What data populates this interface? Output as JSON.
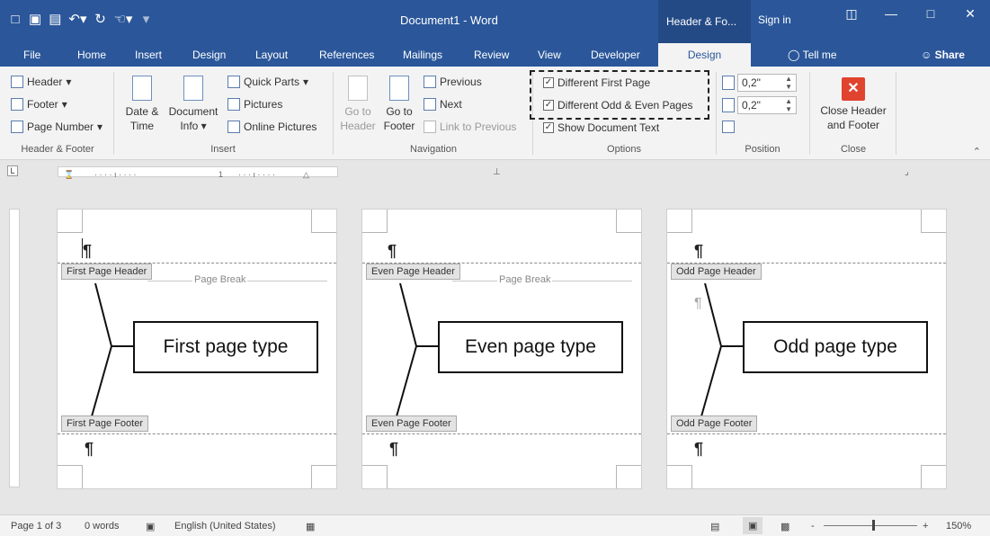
{
  "titlebar": {
    "qat_icons": [
      "new-document-icon",
      "save-icon",
      "save-as-icon",
      "undo-icon",
      "redo-icon",
      "touch-mode-icon",
      "customize-icon"
    ],
    "doc_title": "Document1  -  Word",
    "context_title": "Header & Fo...",
    "signin": "Sign in",
    "window_buttons": [
      "ribbon-display-icon",
      "minimize-icon",
      "maximize-icon",
      "close-icon"
    ]
  },
  "tabs": {
    "items": [
      "File",
      "Home",
      "Insert",
      "Design",
      "Layout",
      "References",
      "Mailings",
      "Review",
      "View",
      "Developer"
    ],
    "active": "Design",
    "tellme": "Tell me",
    "share": "Share"
  },
  "ribbon": {
    "header_footer": {
      "header": "Header",
      "footer": "Footer",
      "page_number": "Page Number",
      "label": "Header & Footer"
    },
    "insert": {
      "date_time_1": "Date &",
      "date_time_2": "Time",
      "doc_info_1": "Document",
      "doc_info_2": "Info",
      "quick_parts": "Quick Parts",
      "pictures": "Pictures",
      "online_pictures": "Online Pictures",
      "label": "Insert"
    },
    "navigation": {
      "goto_header_1": "Go to",
      "goto_header_2": "Header",
      "goto_footer_1": "Go to",
      "goto_footer_2": "Footer",
      "previous": "Previous",
      "next": "Next",
      "link_previous": "Link to Previous",
      "label": "Navigation"
    },
    "options": {
      "diff_first": "Different First Page",
      "diff_odd_even": "Different Odd & Even Pages",
      "show_doc_text": "Show Document Text",
      "label": "Options"
    },
    "position": {
      "header_pos": "0,2\"",
      "footer_pos": "0,2\"",
      "label": "Position"
    },
    "close": {
      "line1": "Close Header",
      "line2": "and Footer",
      "label": "Close"
    }
  },
  "ruler": {
    "corner": "L",
    "mark_1": "1"
  },
  "pages": [
    {
      "header_tag": "First Page Header",
      "footer_tag": "First Page Footer",
      "page_break": "Page Break",
      "type_label": "First page type"
    },
    {
      "header_tag": "Even Page Header",
      "footer_tag": "Even Page Footer",
      "page_break": "Page Break",
      "type_label": "Even page type"
    },
    {
      "header_tag": "Odd Page Header",
      "footer_tag": "Odd Page Footer",
      "type_label": "Odd page type"
    }
  ],
  "pilcrow": "¶",
  "status": {
    "page": "Page 1 of 3",
    "words": "0 words",
    "language": "English (United States)",
    "zoom": "150%",
    "zoom_minus": "-",
    "zoom_plus": "+"
  }
}
